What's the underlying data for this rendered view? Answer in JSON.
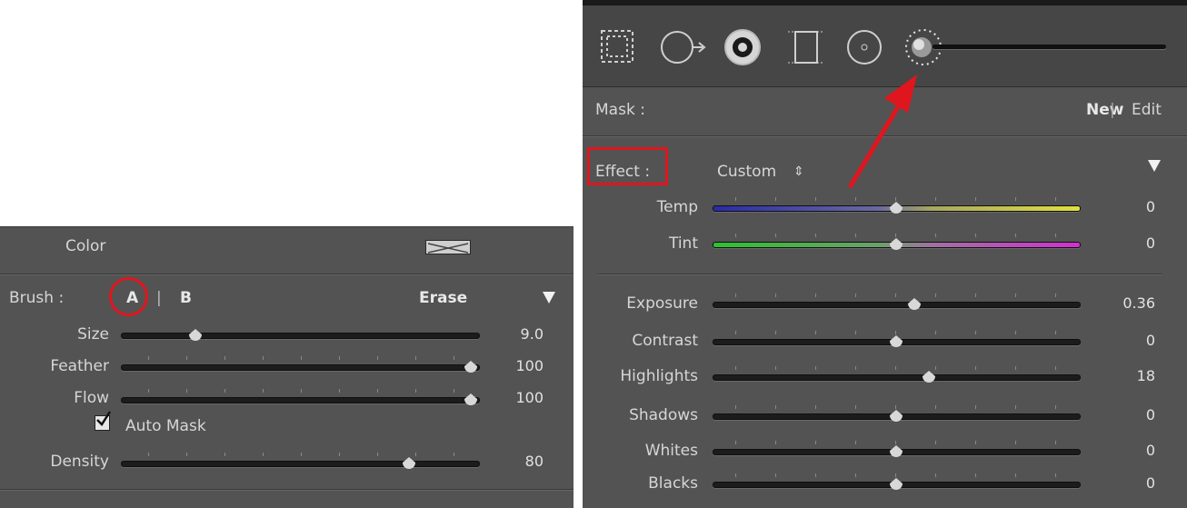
{
  "left": {
    "color_label": "Color",
    "brush_label": "Brush :",
    "brush_a": "A",
    "brush_sep": "|",
    "brush_b": "B",
    "erase": "Erase",
    "size_label": "Size",
    "size_value": "9.0",
    "size_pos": 0.11,
    "feather_label": "Feather",
    "feather_value": "100",
    "feather_pos": 1.0,
    "flow_label": "Flow",
    "flow_value": "100",
    "flow_pos": 1.0,
    "auto_mask": "Auto Mask",
    "auto_mask_checked": true,
    "density_label": "Density",
    "density_value": "80",
    "density_pos": 0.8
  },
  "right": {
    "tools": [
      "crop-overlay-icon",
      "spot-removal-icon",
      "red-eye-icon",
      "graduated-filter-icon",
      "radial-filter-icon",
      "adjustment-brush-icon"
    ],
    "mask_label": "Mask :",
    "new": "New",
    "sep": "|",
    "edit": "Edit",
    "effect_label": "Effect :",
    "effect_value": "Custom",
    "effect_arrows": "⇕",
    "sliders": [
      {
        "label": "Temp",
        "value": "0",
        "pos": 0.5,
        "track": "temp"
      },
      {
        "label": "Tint",
        "value": "0",
        "pos": 0.5,
        "track": "tint"
      },
      {
        "label": "Exposure",
        "value": "0.36",
        "pos": 0.55,
        "track": "gray"
      },
      {
        "label": "Contrast",
        "value": "0",
        "pos": 0.5,
        "track": "gray"
      },
      {
        "label": "Highlights",
        "value": "18",
        "pos": 0.59,
        "track": "gray"
      },
      {
        "label": "Shadows",
        "value": "0",
        "pos": 0.5,
        "track": "gray"
      },
      {
        "label": "Whites",
        "value": "0",
        "pos": 0.5,
        "track": "gray"
      },
      {
        "label": "Blacks",
        "value": "0",
        "pos": 0.5,
        "track": "gray"
      }
    ]
  },
  "colors": {
    "annotation_red": "#e0161e",
    "panel": "#535353"
  }
}
